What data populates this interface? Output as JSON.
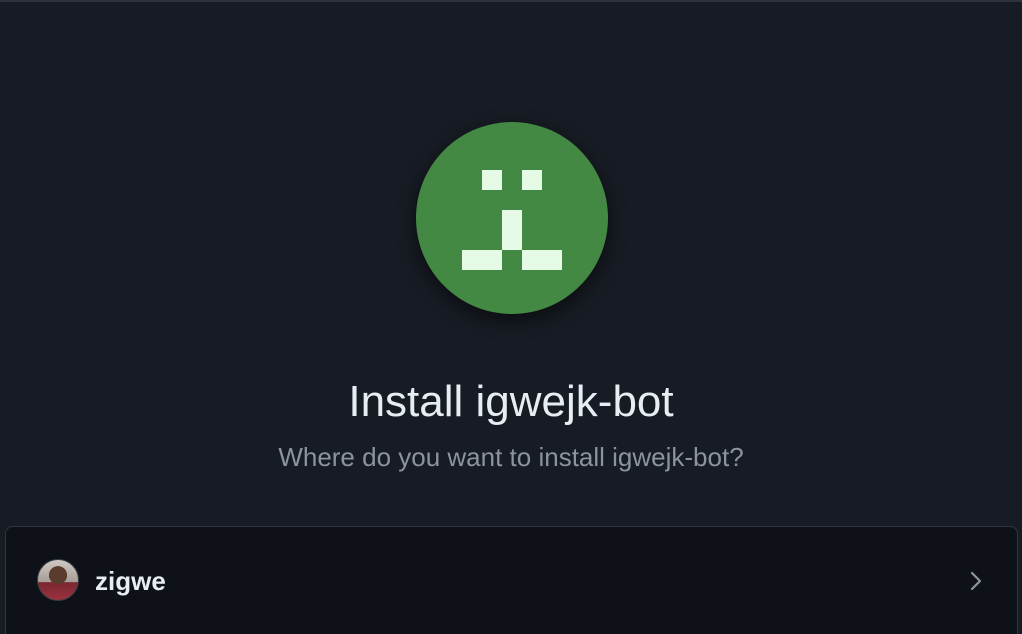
{
  "app": {
    "logo_icon": "pixel-face-icon",
    "logo_color": "#438843",
    "logo_pixel_color": "#e6fbe6"
  },
  "header": {
    "title": "Install igwejk-bot",
    "subtitle": "Where do you want to install igwejk-bot?"
  },
  "accounts": [
    {
      "name": "zigwe",
      "avatar_icon": "user-avatar",
      "action_icon": "chevron-right-icon"
    }
  ]
}
